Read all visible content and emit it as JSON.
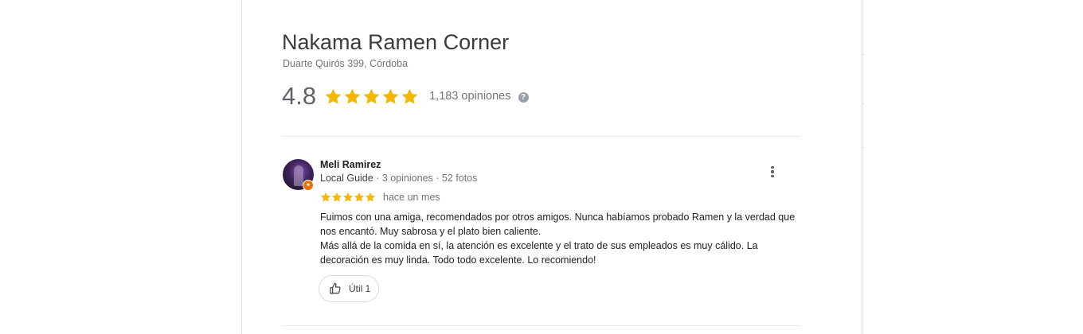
{
  "place": {
    "name": "Nakama Ramen Corner",
    "address": "Duarte Quirós 399, Córdoba",
    "rating": "4.8",
    "rating_value": 4.8,
    "rating_max": 5,
    "review_count": "1,183 opiniones",
    "help_icon_glyph": "?"
  },
  "review": {
    "author": "Meli Ramirez",
    "author_level": "Local Guide",
    "separator_1": " · ",
    "review_stats": "3 opiniones",
    "separator_2": " · ",
    "photo_stats": "52 fotos",
    "stars": 5,
    "date": "hace un mes",
    "text_paragraph_1": "Fuimos con una amiga, recomendados por otros amigos. Nunca habíamos probado Ramen y la verdad que nos encantó. Muy sabrosa y el plato bien caliente.",
    "text_paragraph_2": "Más allá de la comida en sí, la atención es excelente y el trato de sus empleados es muy cálido. La decoración es muy linda. Todo todo excelente. Lo recomiendo!",
    "helpful_label": "Útil 1"
  },
  "icons": {
    "star": "star-icon",
    "help": "help-icon",
    "more": "more-vert-icon",
    "thumbs_up": "thumbs-up-icon",
    "local_guide_badge": "local-guide-badge-icon"
  },
  "colors": {
    "star": "#f5b800",
    "local_guide_badge": "#e8710a",
    "title": "#3c3c3c",
    "secondary_text": "#70757a"
  }
}
